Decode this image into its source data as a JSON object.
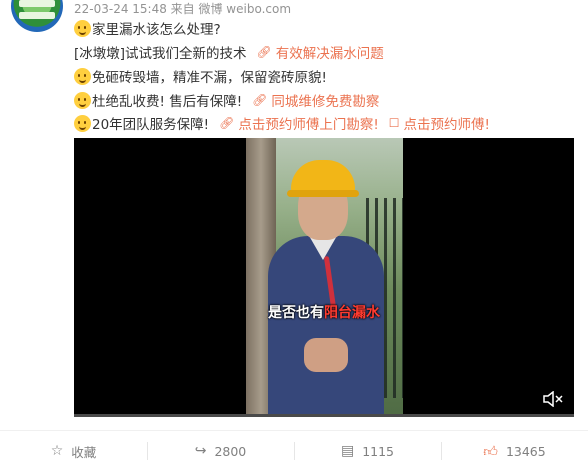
{
  "meta": "22-03-24 15:48 来自 微博 weibo.com",
  "lines": [
    {
      "text": "家里漏水该怎么处理?",
      "emoji": "crying-face-emoji"
    },
    {
      "text": "[冰墩墩]试试我们全新的技术",
      "link": "有效解决漏水问题"
    },
    {
      "text": "免砸砖毁墙，精准不漏，保留瓷砖原貌!",
      "emoji": "smiling-face-emoji"
    },
    {
      "text": "杜绝乱收费! 售后有保障!",
      "emoji": "shushing-face-emoji",
      "link": "同城维修免费勘察"
    },
    {
      "text": "20年团队服务保障!",
      "emoji": "thinking-face-emoji",
      "link": "点击预约师傅上门勘察!",
      "link2": "点击预约师傅!"
    }
  ],
  "video": {
    "subtitle_before": "是否也有",
    "subtitle_highlight": "阳台漏水",
    "mute_icon": "speaker-muted-icon"
  },
  "actions": {
    "favorite": "收藏",
    "repost": "2800",
    "comment": "1115",
    "like": "13465"
  },
  "colors": {
    "link": "#eb7350",
    "meta": "#939393",
    "accent": "#eb7350"
  }
}
